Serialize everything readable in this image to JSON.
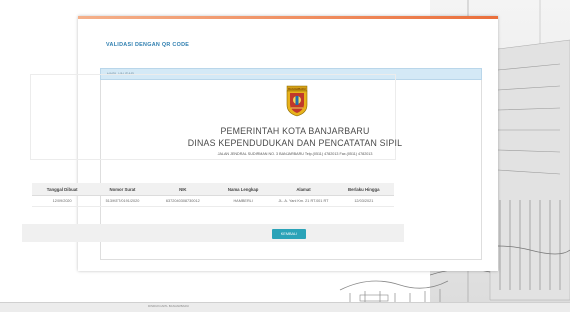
{
  "page": {
    "title": "VALIDASI DENGAN QR CODE",
    "panel_header": "HASIL VALIDASI"
  },
  "government": {
    "line1": "PEMERINTAH KOTA BANJARBARU",
    "line2": "DINAS KEPENDUDUKAN DAN PENCATATAN SIPIL",
    "address": "JALAN JENDRAL SUDIRMAN NO. 3 BANJARBARU Telp.(0511) 4782013 Fax.(0511) 4782013",
    "emblem_text": "BANJARBARU"
  },
  "table": {
    "headers": [
      "Tanggal Dibuat",
      "Nomor Surat",
      "NIK",
      "Nama Lengkap",
      "Alamat",
      "Berlaku Hingga"
    ],
    "rows": [
      [
        "12/09/2020",
        "513/KET/0191/2020",
        "6372040308730012",
        "HAMBERLI",
        "JL. A. Yani Km. 21 RT.001 RT",
        "12/03/2021"
      ]
    ]
  },
  "buttons": {
    "back": "KEMBALI"
  },
  "footer": {
    "text": "DISDUKCAPIL BANJARBARU"
  },
  "colors": {
    "accent": "#2f7fb0",
    "panel_header_bg": "#d4e9f6",
    "button": "#2aa3b8",
    "top_bar": "#ea6f3c"
  }
}
